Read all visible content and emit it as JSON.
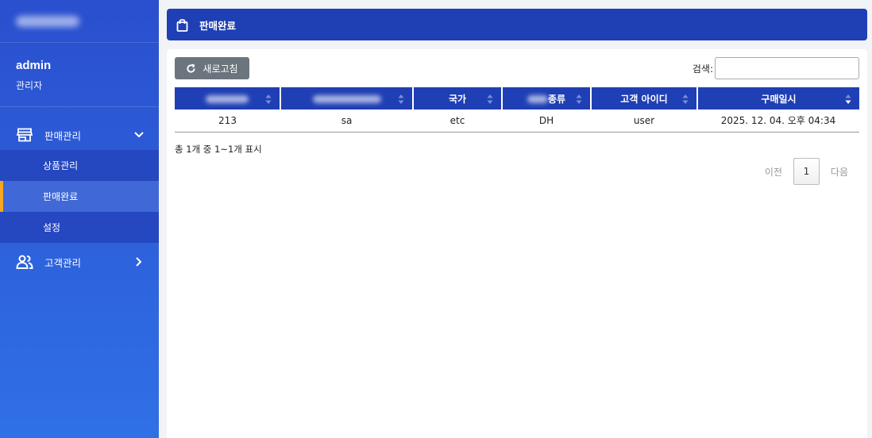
{
  "user": {
    "name": "admin",
    "role": "관리자"
  },
  "sidebar": {
    "groups": [
      {
        "label": "판매관리",
        "icon": "store-icon",
        "expanded": true,
        "items": [
          {
            "label": "상품관리",
            "active": false
          },
          {
            "label": "판매완료",
            "active": true
          },
          {
            "label": "설정",
            "active": false
          }
        ]
      },
      {
        "label": "고객관리",
        "icon": "users-icon",
        "expanded": false
      }
    ]
  },
  "header": {
    "title": "판매완료",
    "icon": "shopping-bag-icon"
  },
  "toolbar": {
    "refresh_label": "새로고침",
    "search_label": "검색:",
    "search_value": ""
  },
  "table": {
    "columns": [
      {
        "label": "",
        "blurred": true
      },
      {
        "label": "",
        "blurred": true
      },
      {
        "label": "국가",
        "blurred": false
      },
      {
        "label": "종류",
        "blurred_prefix": true
      },
      {
        "label": "고객 아이디",
        "blurred": false
      },
      {
        "label": "구매일시",
        "blurred": false
      }
    ],
    "rows": [
      [
        "213",
        "sa",
        "etc",
        "DH",
        "user",
        "2025. 12. 04. 오후 04:34"
      ]
    ]
  },
  "info_text": "총 1개 중 1~1개 표시",
  "pagination": {
    "prev": "이전",
    "current": "1",
    "next": "다음"
  },
  "colors": {
    "primary": "#1f3fb4",
    "accent": "#f5a623",
    "button": "#6c757d"
  }
}
